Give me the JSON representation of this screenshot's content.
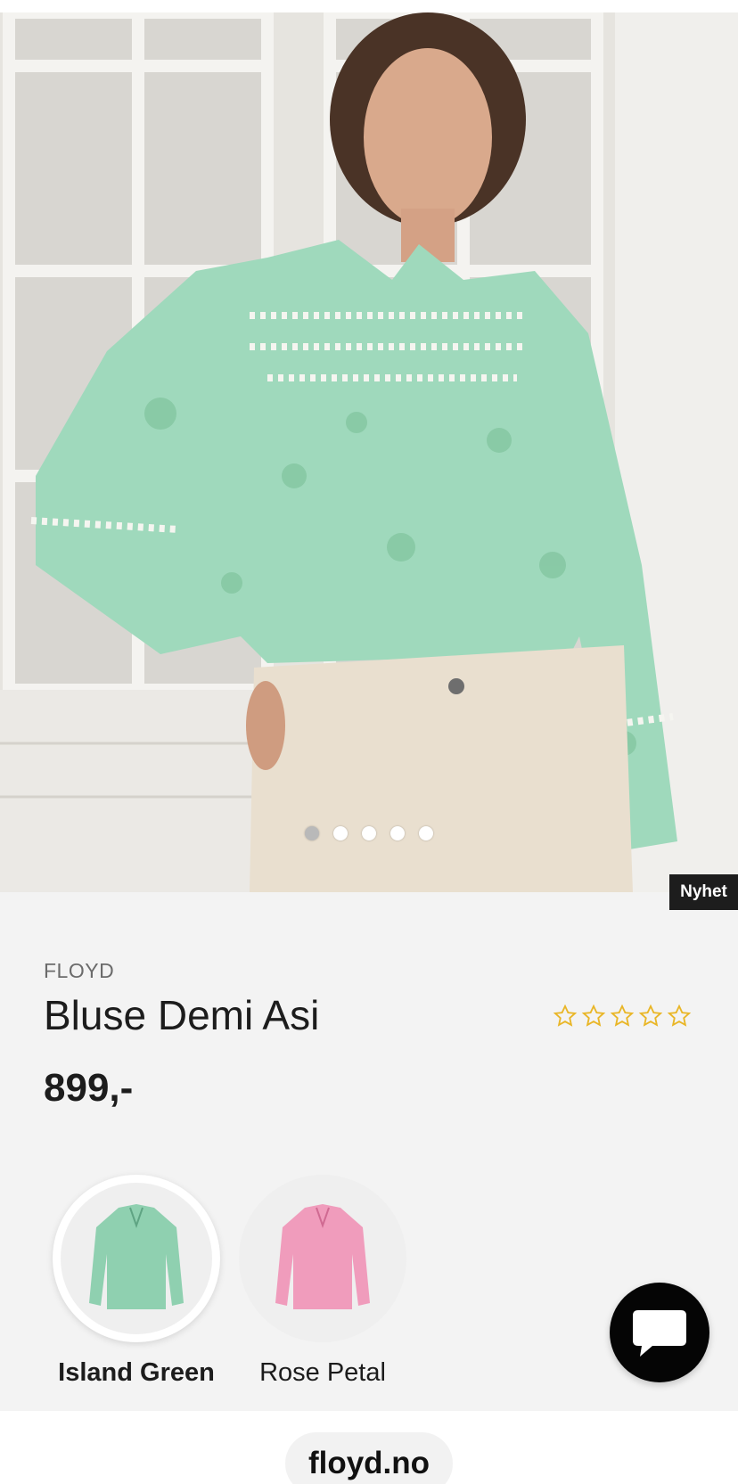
{
  "product": {
    "brand": "FLOYD",
    "name": "Bluse Demi Asi",
    "price": "899,-",
    "badge": "Nyhet",
    "rating": {
      "value": 0,
      "max": 5
    }
  },
  "gallery": {
    "image_alt": "Model wearing green floral blouse with cream jeans",
    "slide_count": 5,
    "active_slide": 1
  },
  "colors": {
    "options": [
      {
        "label": "Island Green",
        "selected": true,
        "swatch": "#8fd0b0"
      },
      {
        "label": "Rose Petal",
        "selected": false,
        "swatch": "#f09cbc"
      }
    ]
  },
  "chat": {
    "icon": "chat-bubble-icon"
  },
  "browser": {
    "domain": "floyd.no"
  },
  "theme": {
    "star_color": "#e9b627",
    "badge_bg": "#1d1d1d",
    "page_bg": "#f3f3f3"
  }
}
